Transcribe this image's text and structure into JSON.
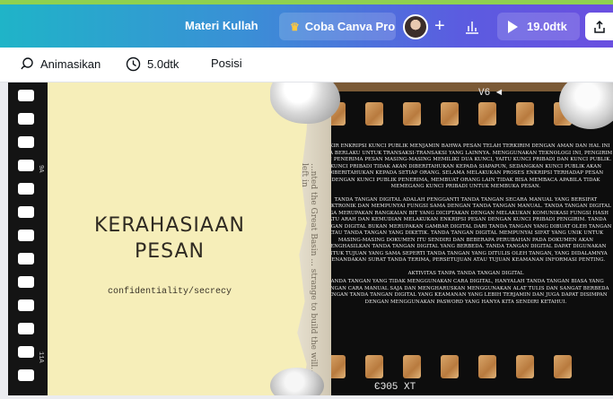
{
  "header": {
    "title": "Materi Kullah",
    "pro_label": "Coba Canva Pro",
    "duration_label": "19.0dtk",
    "icons": {
      "crown": "crown-icon",
      "add": "plus-icon",
      "stats": "chart-icon",
      "play": "play-icon",
      "share": "share-icon"
    }
  },
  "toolbar": {
    "animate_label": "Animasikan",
    "duration_label": "5.0dtk",
    "position_label": "Posisi"
  },
  "slide": {
    "title_line1": "KERAHASIAAN",
    "title_line2": "PESAN",
    "subtitle": "confidentiality/secrecy",
    "film_top_label": "V6 ◄",
    "film_bottom_label": "ЄЭ05 ХТ",
    "film_left_labels": [
      "9A",
      "11A"
    ],
    "torn_text": "...nted the Great Basin ... strange to build the will... and left in",
    "paragraphs": [
      "Enkir enkripsi kunci publik menjamin bahwa pesan telah terkirim dengan aman dan hal ini juga berlaku untuk transaksi-transaksi yang lainnya. Menggunakan teknologi ini, pengirim dan penerima pesan masing-masing memiliki dua kunci, yaitu kunci pribadi dan kunci publik. Kunci pribadi tidak akan diberitahukan kepada siapapun, sedangkan kunci publik akan diberitahukan kepada setiap orang. Selama melakukan proses enkripsi terhadap pesan dengan kunci publik penerima, membuat orang lain tidak bisa membaca apabila tidak memegang kunci pribadi untuk membuka pesan.",
      "Tanda tangan digital adalah pengganti tanda tangan secara manual yang bersifat elektronik dan mempunyai fungsi sama dengan tanda tangan manual. Tanda tangan digital juga merupakan rangkaian bit yang diciptakan dengan melakukan komunikasi fungsi hash satu arah dan kemudian melakukan enkripsi pesan dengan kunci pribadi pengirim. Tanda tangan digital bukan merupakan gambar digital dari tanda tangan yang dibuat oleh tangan atau tanda tangan yang diketik. Tanda tangan digital mempunyai sifat yang unik untuk masing-masing dokumen itu sendiri dan beberapa perubahan pada dokumen akan menghasilkan tanda tangan digital yang berbeda. Tanda tangan digital dapat digunakan untuk tujuan yang sama seperti tanda tangan yang ditulis oleh tangan, yang didalamnya menandakan surat tanda terima, persetujuan atau tujuan keamanan informasi penting.",
      "Aktivitas tanpa tanda tangan digital",
      "Tanda tangan yang tidak menggunakan cara digital, hanyalah tanda tangan biasa yang dengan cara manual saja dan mengharuskan menggunakan alat tulis dan sangat berbeda dengan tanda tangan digital yang keamanan yang lebih terjamin dan juga dapat disimpan dengan menggunakan pasword yang hanya kita sendiri ketahui."
    ]
  },
  "colors": {
    "panel_yellow": "#f6eeb9",
    "film_black": "#0d0d0d",
    "header_gradient_start": "#1fb4c8",
    "header_gradient_end": "#6a4fe0"
  }
}
